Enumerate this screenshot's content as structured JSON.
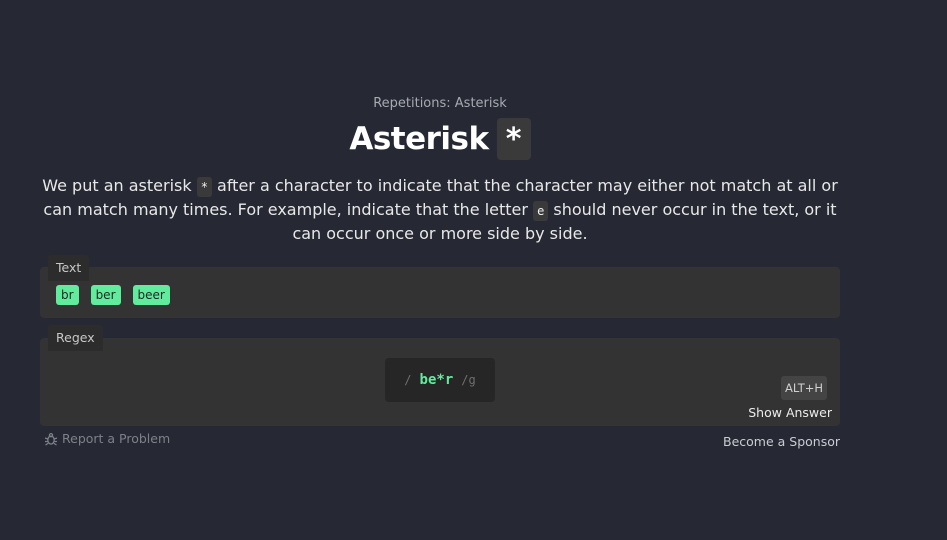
{
  "lesson": {
    "subtitle": "Repetitions: Asterisk",
    "title": "Asterisk",
    "title_symbol": "*",
    "description": {
      "part1": "We put an asterisk ",
      "code1": "*",
      "part2": " after a character to indicate that the character may either not match at all or can match many times. For example, indicate that the letter ",
      "code2": "e",
      "part3": " should never occur in the text, or it can occur once or more side by side."
    }
  },
  "text_panel": {
    "label": "Text",
    "matches": [
      "br",
      "ber",
      "beer"
    ]
  },
  "regex_panel": {
    "label": "Regex",
    "open_slash": "/",
    "value": "be*r",
    "flags": "/g",
    "shortcut": "ALT+H",
    "show_answer": "Show Answer"
  },
  "footer": {
    "report": "Report a Problem",
    "report_icon": "bug-icon",
    "sponsor": "Become a Sponsor"
  },
  "colors": {
    "background": "#262933",
    "panel": "#333333",
    "match": "#61eb9d"
  }
}
